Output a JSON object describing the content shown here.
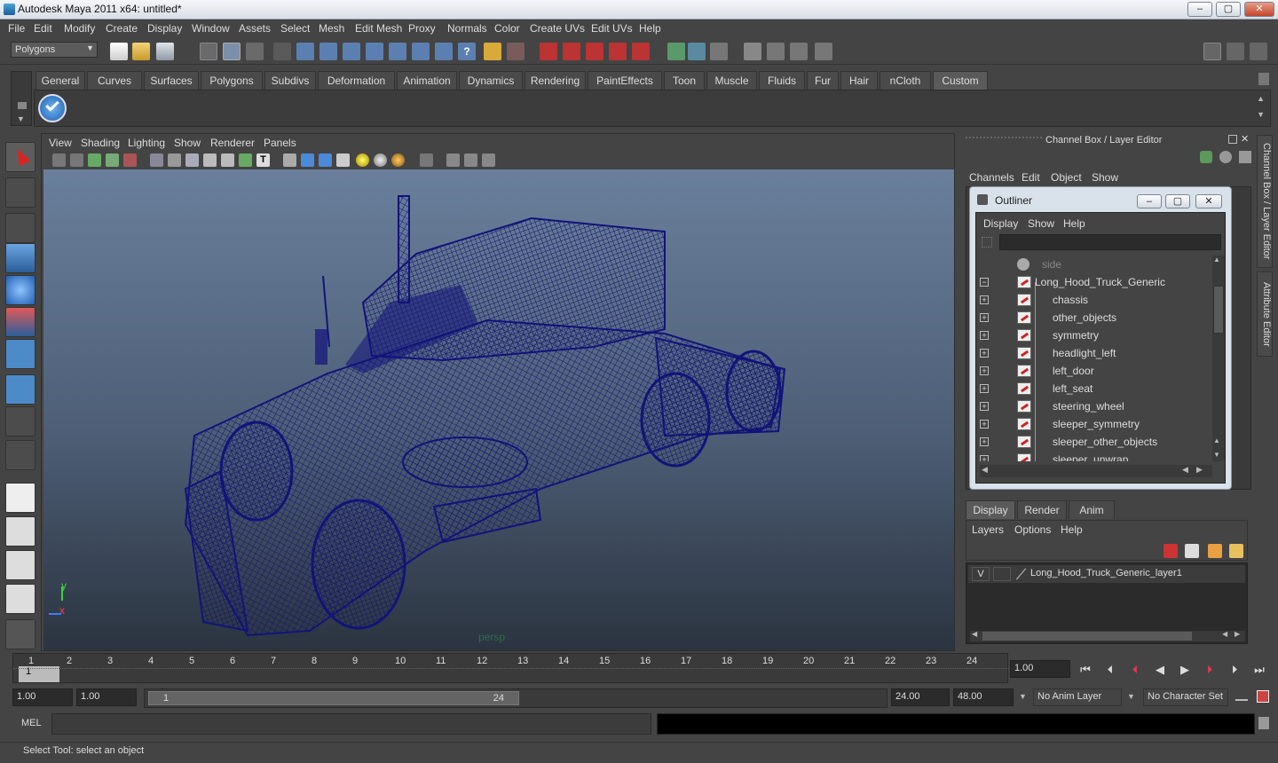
{
  "window": {
    "title": "Autodesk Maya 2011 x64: untitled*",
    "min": "‒",
    "max": "▢",
    "close": "✕"
  },
  "menu": [
    "File",
    "Edit",
    "Modify",
    "Create",
    "Display",
    "Window",
    "Assets",
    "Select",
    "Mesh",
    "Edit Mesh",
    "Proxy",
    "Normals",
    "Color",
    "Create UVs",
    "Edit UVs",
    "Help"
  ],
  "toolbar": {
    "mode": "Polygons"
  },
  "shelf": {
    "tabs": [
      "General",
      "Curves",
      "Surfaces",
      "Polygons",
      "Subdivs",
      "Deformation",
      "Animation",
      "Dynamics",
      "Rendering",
      "PaintEffects",
      "Toon",
      "Muscle",
      "Fluids",
      "Fur",
      "Hair",
      "nCloth",
      "Custom"
    ],
    "active": "Custom"
  },
  "viewport": {
    "menus": [
      "View",
      "Shading",
      "Lighting",
      "Show",
      "Renderer",
      "Panels"
    ],
    "camera_label": "persp",
    "axis_x": "x",
    "axis_y": "y"
  },
  "channel_box": {
    "title": "Channel Box / Layer Editor",
    "menus": [
      "Channels",
      "Edit",
      "Object",
      "Show"
    ]
  },
  "outliner": {
    "title": "Outliner",
    "menus": [
      "Display",
      "Show",
      "Help"
    ],
    "items": [
      {
        "name": "side",
        "dim": true
      },
      {
        "name": "Long_Hood_Truck_Generic",
        "expanded": true
      },
      {
        "name": "chassis"
      },
      {
        "name": "other_objects"
      },
      {
        "name": "symmetry"
      },
      {
        "name": "headlight_left"
      },
      {
        "name": "left_door"
      },
      {
        "name": "left_seat"
      },
      {
        "name": "steering_wheel"
      },
      {
        "name": "sleeper_symmetry"
      },
      {
        "name": "sleeper_other_objects"
      },
      {
        "name": "sleeper_unwrap"
      }
    ]
  },
  "layer_editor": {
    "tabs": [
      "Display",
      "Render",
      "Anim"
    ],
    "menus": [
      "Layers",
      "Options",
      "Help"
    ],
    "layer": {
      "visible": "V",
      "name": "Long_Hood_Truck_Generic_layer1"
    }
  },
  "side_tabs": [
    "Channel Box / Layer Editor",
    "Attribute Editor"
  ],
  "timeline": {
    "ticks": [
      "1",
      "2",
      "3",
      "4",
      "5",
      "6",
      "7",
      "8",
      "9",
      "10",
      "11",
      "12",
      "13",
      "14",
      "15",
      "16",
      "17",
      "18",
      "19",
      "20",
      "21",
      "22",
      "23",
      "24"
    ],
    "current_frame_marker": "1",
    "current_time": "1.00"
  },
  "range": {
    "start": "1.00",
    "inner_start": "1.00",
    "slider_start": "1",
    "slider_end": "24",
    "end": "24.00",
    "outer_end": "48.00",
    "anim_layer": "No Anim Layer",
    "character_set": "No Character Set"
  },
  "command_line": {
    "label": "MEL"
  },
  "help_line": {
    "text": "Select Tool: select an object"
  },
  "colors": {
    "wire": "#12137a",
    "accent": "#5a5a5a"
  }
}
